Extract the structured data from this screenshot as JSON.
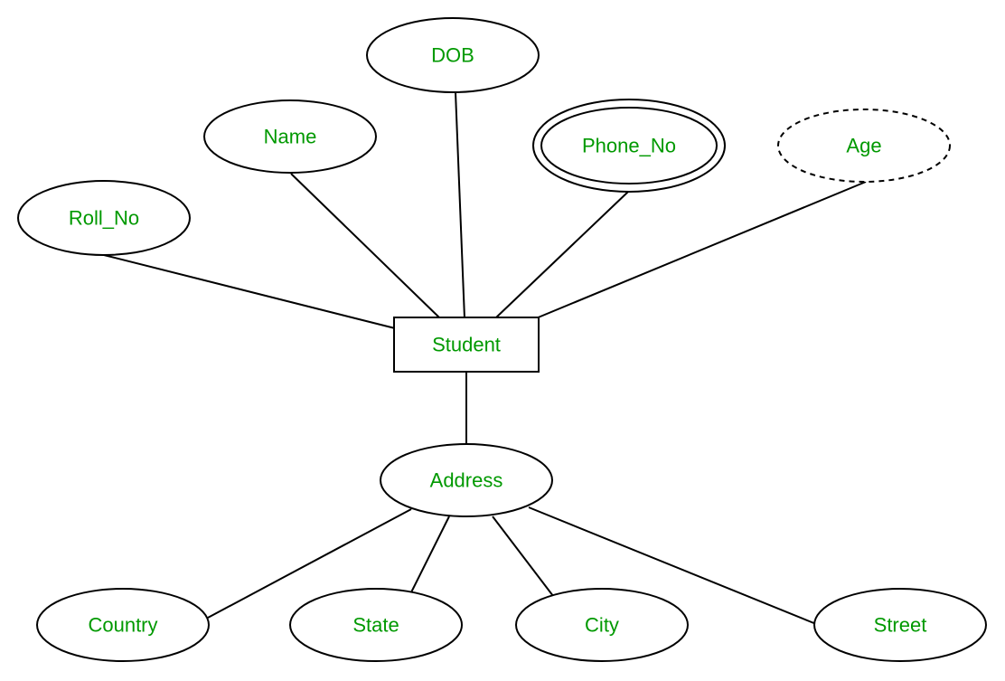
{
  "diagram": {
    "type": "ER diagram",
    "label_color": "#009900",
    "line_color": "#000000",
    "entity": {
      "id": "student",
      "label": "Student",
      "kind": "entity"
    },
    "attributes": [
      {
        "id": "roll_no",
        "label": "Roll_No",
        "kind": "simple",
        "parent": "student"
      },
      {
        "id": "name",
        "label": "Name",
        "kind": "simple",
        "parent": "student"
      },
      {
        "id": "dob",
        "label": "DOB",
        "kind": "simple",
        "parent": "student"
      },
      {
        "id": "phone_no",
        "label": "Phone_No",
        "kind": "multivalued",
        "parent": "student"
      },
      {
        "id": "age",
        "label": "Age",
        "kind": "derived",
        "parent": "student"
      },
      {
        "id": "address",
        "label": "Address",
        "kind": "composite",
        "parent": "student"
      },
      {
        "id": "country",
        "label": "Country",
        "kind": "simple",
        "parent": "address"
      },
      {
        "id": "state",
        "label": "State",
        "kind": "simple",
        "parent": "address"
      },
      {
        "id": "city",
        "label": "City",
        "kind": "simple",
        "parent": "address"
      },
      {
        "id": "street",
        "label": "Street",
        "kind": "simple",
        "parent": "address"
      }
    ]
  }
}
